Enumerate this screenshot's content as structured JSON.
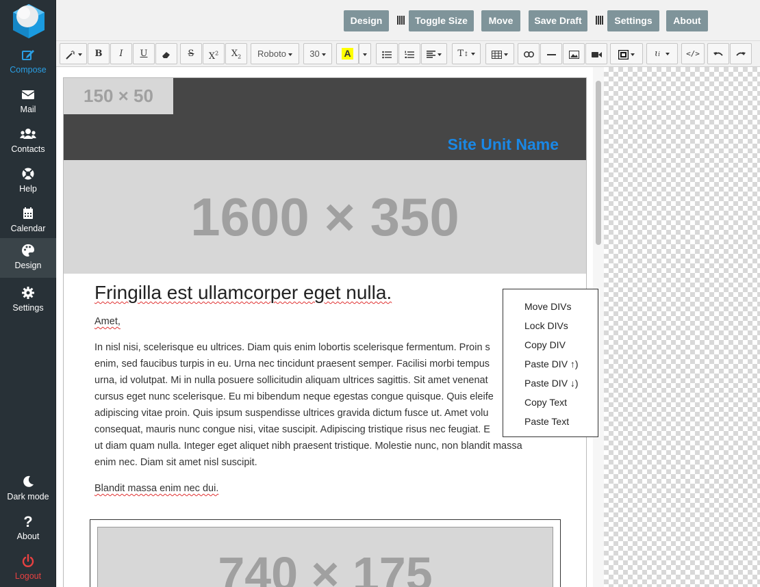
{
  "sidebar": {
    "items": [
      {
        "label": "Compose",
        "icon": "compose-icon"
      },
      {
        "label": "Mail",
        "icon": "mail-icon"
      },
      {
        "label": "Contacts",
        "icon": "contacts-icon"
      },
      {
        "label": "Help",
        "icon": "lifebuoy-icon"
      },
      {
        "label": "Calendar",
        "icon": "calendar-icon"
      },
      {
        "label": "Design",
        "icon": "palette-icon"
      },
      {
        "label": "Settings",
        "icon": "gear-icon"
      }
    ],
    "bottom": [
      {
        "label": "Dark mode",
        "icon": "moon-icon"
      },
      {
        "label": "About",
        "icon": "question-icon"
      },
      {
        "label": "Logout",
        "icon": "power-icon"
      }
    ]
  },
  "topbar": {
    "design": "Design",
    "toggle_size": "Toggle Size",
    "move": "Move",
    "save_draft": "Save Draft",
    "settings": "Settings",
    "about": "About"
  },
  "toolbar": {
    "font_family": "Roboto",
    "font_size": "30"
  },
  "document": {
    "logo_placeholder": "150 × 50",
    "site_name": "Site Unit Name",
    "hero_placeholder": "1600 × 350",
    "headline": "Fringilla est ullamcorper eget nulla.",
    "greeting": "Amet,",
    "body": "In nisl nisi, scelerisque eu ultrices. Diam quis enim lobortis scelerisque fermentum. Proin s enim, sed faucibus turpis in eu. Urna nec tincidunt praesent semper. Facilisi morbi tempus urna, id volutpat. Mi in nulla posuere sollicitudin aliquam ultrices sagittis. Sit amet venenat cursus eget nunc scelerisque. Eu mi bibendum neque egestas congue quisque. Quis eleife adipiscing vitae proin. Quis ipsum suspendisse ultrices gravida dictum fusce ut. Amet volu consequat, mauris nunc congue nisi, vitae suscipit. Adipiscing tristique risus nec feugiat. E ut diam quam nulla. Integer eget aliquet nibh praesent tristique. Molestie nunc, non blandit massa enim nec. Diam sit amet nisl suscipit.",
    "body_lines": [
      "In nisl nisi, scelerisque eu ultrices. Diam quis enim lobortis scelerisque fermentum. Proin s",
      "enim, sed faucibus turpis in eu. Urna nec tincidunt praesent semper. Facilisi morbi tempus",
      "urna, id volutpat. Mi in nulla posuere sollicitudin aliquam ultrices sagittis. Sit amet venenat",
      "cursus eget nunc scelerisque. Eu mi bibendum neque egestas congue quisque. Quis eleife",
      "adipiscing vitae proin. Quis ipsum suspendisse ultrices gravida dictum fusce ut. Amet volu",
      "consequat, mauris nunc congue nisi, vitae suscipit. Adipiscing tristique risus nec feugiat. E",
      "ut diam quam nulla. Integer eget aliquet nibh praesent tristique. Molestie nunc, non blandit massa",
      "enim nec. Diam sit amet nisl suscipit."
    ],
    "closing": "Blandit massa enim nec dui.",
    "card_placeholder": "740 × 175"
  },
  "context_menu": {
    "items": [
      "Move DIVs",
      "Lock DIVs",
      "Copy DIV",
      "Paste DIV ↑)",
      "Paste DIV ↓)",
      "Copy Text",
      "Paste Text"
    ]
  },
  "colors": {
    "sidebar_bg": "#283137",
    "accent_blue": "#2a9fe4",
    "site_name": "#1a88e6",
    "button_bg": "#7f949a",
    "logout": "#e84141",
    "header_bg": "#464646"
  }
}
